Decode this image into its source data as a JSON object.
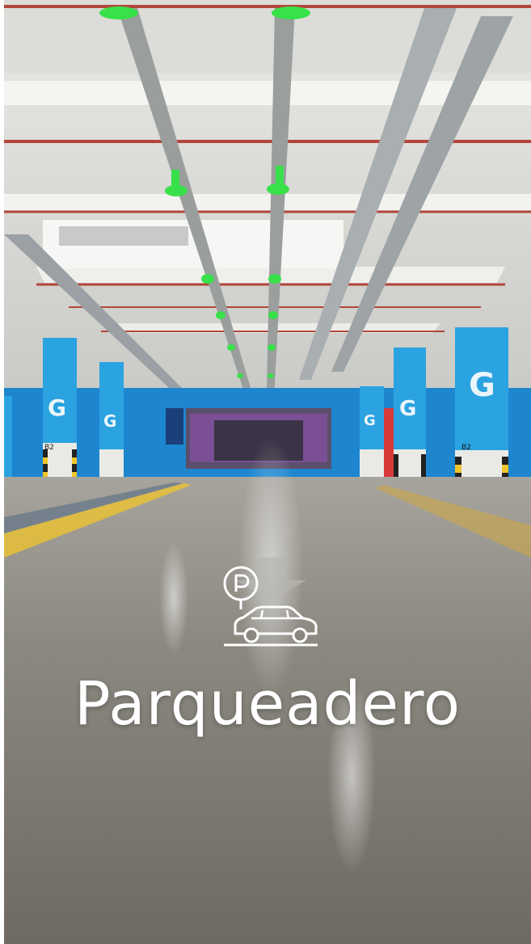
{
  "card": {
    "title": "Parqueadero",
    "icon": "parking-car-icon",
    "pillar_letter": "G",
    "pillar_level": "B2"
  },
  "colors": {
    "pillar_blue": "#2aa3e0",
    "wall_blue": "#1d86cf",
    "guide_light_green": "#38e14a",
    "pipe_red": "#b2463a",
    "floor": "#8a8780",
    "title_white": "#ffffff"
  }
}
